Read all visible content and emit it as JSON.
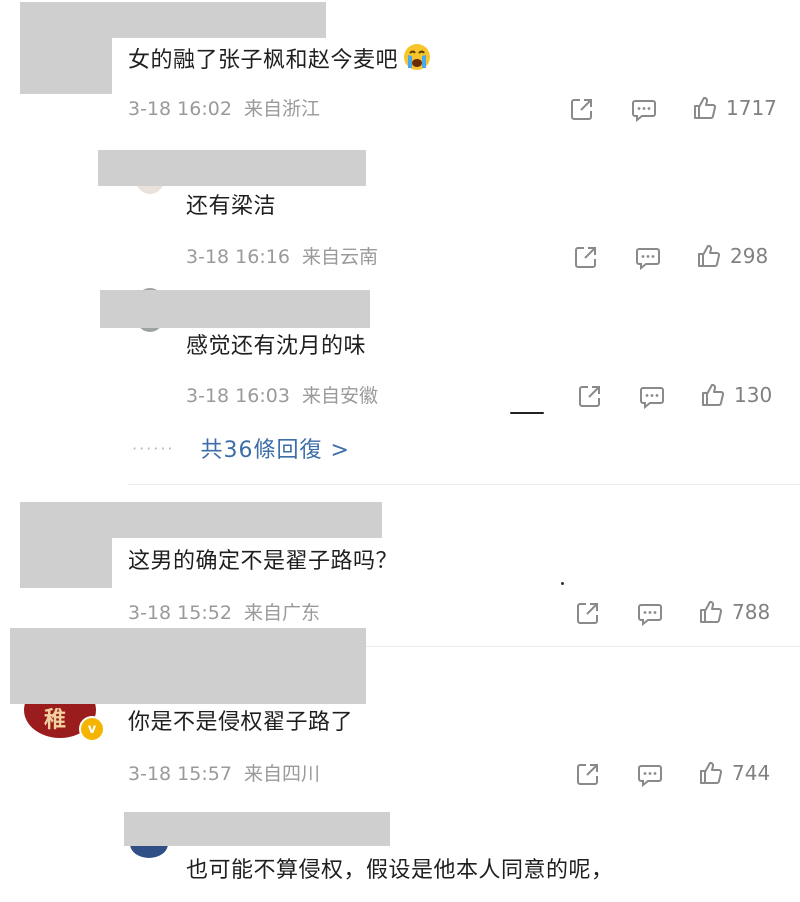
{
  "comments": [
    {
      "text": "女的融了张子枫和赵今麦吧",
      "date": "3-18 16:02",
      "location": "来自浙江",
      "likes": "1717",
      "emoji": "loudly-crying-face"
    },
    {
      "text": "还有梁洁",
      "date": "3-18 16:16",
      "location": "来自云南",
      "likes": "298"
    },
    {
      "text": "感觉还有沈月的味",
      "date": "3-18 16:03",
      "location": "来自安徽",
      "likes": "130"
    },
    {
      "text": "这男的确定不是翟子路吗？",
      "date": "3-18 15:52",
      "location": "来自广东",
      "likes": "788"
    },
    {
      "text": "你是不是侵权翟子路了",
      "date": "3-18 15:57",
      "location": "来自四川",
      "likes": "744",
      "avatar_text": "稚",
      "badge": "v"
    },
    {
      "text": "也可能不算侵权，假设是他本人同意的呢，"
    }
  ],
  "more_replies": {
    "label": "共36條回復 >"
  },
  "icons": {
    "share": "share-icon",
    "comment": "comment-icon",
    "like": "thumbs-up-icon",
    "dots": "dotted-line-icon"
  },
  "colors": {
    "link": "#3d6ea8",
    "meta": "#9a9a9a",
    "redaction": "#cfcfcf",
    "badge": "#f5b400"
  }
}
